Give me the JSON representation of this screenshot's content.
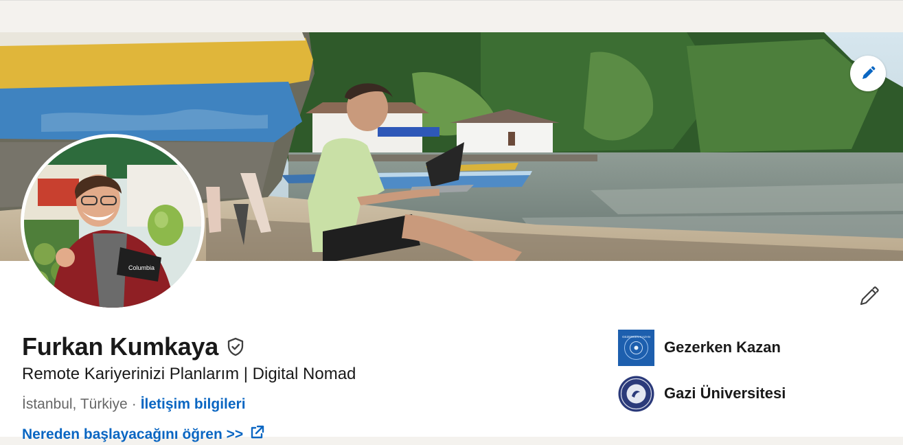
{
  "profile": {
    "name": "Furkan Kumkaya",
    "headline": "Remote Kariyerinizi Planlarım | Digital Nomad",
    "location": "İstanbul, Türkiye",
    "separator": "·",
    "contact_link": "İletişim bilgileri",
    "custom_link": "Nereden başlayacağını öğren >>"
  },
  "organizations": [
    {
      "name": "Gezerken Kazan",
      "logo_text": "GEZERKEN KAZAN"
    },
    {
      "name": "Gazi Üniversitesi"
    }
  ],
  "icons": {
    "cover_edit": "pencil-icon",
    "profile_edit": "pencil-icon",
    "verified": "shield-check-icon",
    "external_link": "external-link-icon"
  },
  "colors": {
    "link": "#0a66c2",
    "text": "#191919",
    "muted": "#666666",
    "page_bg": "#f4f2ee"
  }
}
